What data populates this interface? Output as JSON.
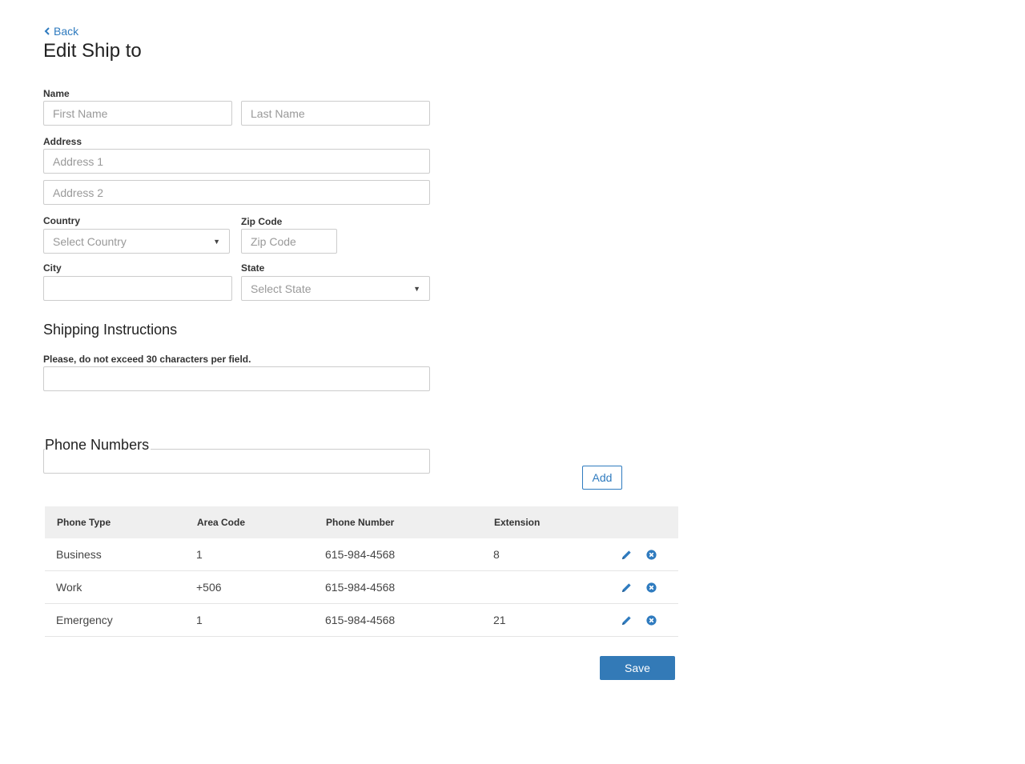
{
  "header": {
    "back_label": "Back",
    "title": "Edit Ship to"
  },
  "form": {
    "name_label": "Name",
    "first_name_placeholder": "First Name",
    "last_name_placeholder": "Last Name",
    "address_label": "Address",
    "address1_placeholder": "Address 1",
    "address2_placeholder": "Address 2",
    "country_label": "Country",
    "country_value": "Select Country",
    "zip_label": "Zip Code",
    "zip_placeholder": "Zip Code",
    "city_label": "City",
    "city_value": "",
    "state_label": "State",
    "state_value": "Select State"
  },
  "shipping": {
    "title": "Shipping Instructions",
    "hint": "Please, do not exceed 30 characters per field.",
    "value": ""
  },
  "phones": {
    "title": "Phone Numbers",
    "input_value": "",
    "add_label": "Add",
    "columns": [
      "Phone Type",
      "Area Code",
      "Phone Number",
      "Extension"
    ],
    "rows": [
      {
        "type": "Business",
        "area": "1",
        "number": "615-984-4568",
        "ext": "8"
      },
      {
        "type": "Work",
        "area": "+506",
        "number": "615-984-4568",
        "ext": ""
      },
      {
        "type": "Emergency",
        "area": "1",
        "number": "615-984-4568",
        "ext": "21"
      }
    ]
  },
  "footer": {
    "save_label": "Save"
  },
  "colors": {
    "accent": "#337ab7",
    "link": "#2f7bbf",
    "header_bg": "#efefef"
  },
  "icons": {
    "edit": "pencil-icon",
    "delete": "remove-circle-icon",
    "back": "chevron-left-icon"
  }
}
